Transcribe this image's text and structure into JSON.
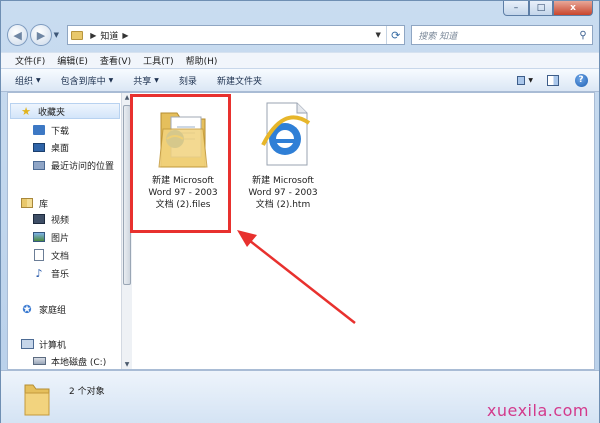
{
  "window": {
    "caption": {
      "minimize": "–",
      "maximize": "□",
      "close": "x"
    }
  },
  "address": {
    "crumb": "知道",
    "search_placeholder": "搜索 知道"
  },
  "menu": [
    "文件(F)",
    "编辑(E)",
    "查看(V)",
    "工具(T)",
    "帮助(H)"
  ],
  "toolbar": {
    "organize": "组织",
    "include_in_library": "包含到库中",
    "share": "共享",
    "burn": "刻录",
    "new_folder": "新建文件夹"
  },
  "navpane": {
    "favorites": "收藏夹",
    "downloads": "下载",
    "desktop": "桌面",
    "recent": "最近访问的位置",
    "libraries": "库",
    "videos": "视频",
    "pictures": "图片",
    "documents": "文档",
    "music": "音乐",
    "homegroup": "家庭组",
    "computer": "计算机",
    "local_disk": "本地磁盘 (C:)"
  },
  "files": [
    {
      "line1": "新建 Microsoft",
      "line2": "Word 97 - 2003",
      "line3": "文档 (2).files"
    },
    {
      "line1": "新建 Microsoft",
      "line2": "Word 97 - 2003",
      "line3": "文档 (2).htm"
    }
  ],
  "status": {
    "count": "2 个对象"
  },
  "watermark": "xuexila.com",
  "colors": {
    "highlight": "#e8312e",
    "watermark": "#d33a8c"
  }
}
